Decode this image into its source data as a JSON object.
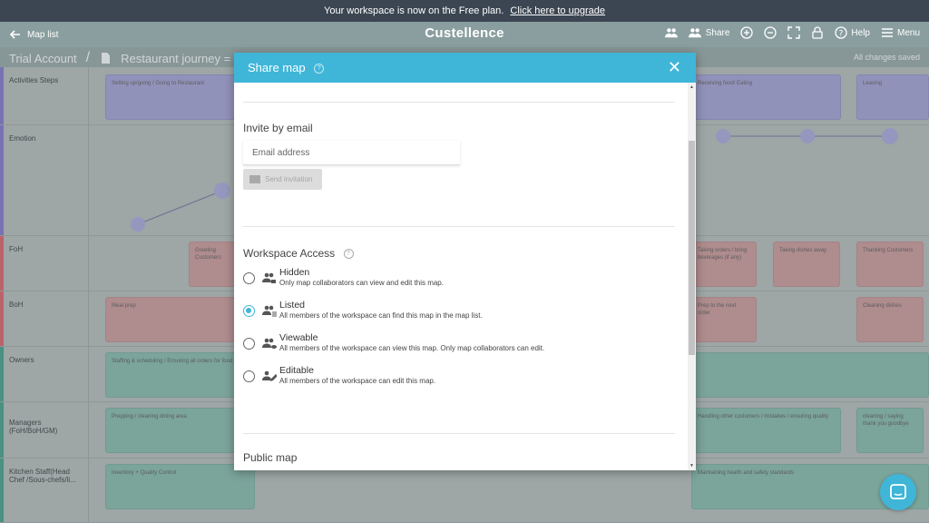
{
  "banner": {
    "message": "Your workspace is now on the Free plan.",
    "upgrade_link": "Click here to upgrade"
  },
  "appbar": {
    "back_label": "Map list",
    "brand": "Custellence",
    "share_label": "Share",
    "help_label": "Help",
    "menu_label": "Menu"
  },
  "subbar": {
    "account": "Trial Account",
    "map_title": "Restaurant journey = fo",
    "saved_status": "All changes saved"
  },
  "rows": [
    {
      "label": "Activities Steps",
      "color": "#7b70c9"
    },
    {
      "label": "Emotion",
      "color": "#7b70c9"
    },
    {
      "label": "FoH",
      "color": "#d45b66"
    },
    {
      "label": "BoH",
      "color": "#d45b66"
    },
    {
      "label": "Owners",
      "color": "#3e9a86"
    },
    {
      "label": "Managers (FoH/BoH/GM)",
      "color": "#3e9a86"
    },
    {
      "label": "Kitchen Staff(Head Chef /Sous-chefs/li...",
      "color": "#3e9a86"
    }
  ],
  "cards": {
    "act1": "Setting up/going / Going to Restaurant",
    "act2": "Receiving food/ Eating",
    "act3": "Leaving",
    "foh1": "Greeting Customers",
    "foh2": "Taking orders / bring beverages (if any)",
    "foh3": "Taking dishes away",
    "foh4": "Thanking Customers",
    "boh1": "Meal prep",
    "boh2": "Prep to the next order",
    "boh3": "Cleaning dishes",
    "own1": "Staffing & scheduling / Ensuring all orders for food",
    "mgr1": "Prepping / cleaning dining area",
    "mgr2": "Handling other customers / mistakes / ensuring quality",
    "mgr3": "cleaning / saying thank you goodbye",
    "kit1": "Inventory + Quality Control",
    "kit2": "Maintaining health and safety standards"
  },
  "modal": {
    "title": "Share map",
    "invite_title": "Invite by email",
    "email_placeholder": "Email address",
    "send_label": "Send invitation",
    "workspace_title": "Workspace Access",
    "public_title": "Public map",
    "selected": "Listed",
    "options": [
      {
        "label": "Hidden",
        "desc": "Only map collaborators can view and edit this map.",
        "icon": "group-lock-icon"
      },
      {
        "label": "Listed",
        "desc": "All members of the workspace can find this map in the map list.",
        "icon": "group-list-icon"
      },
      {
        "label": "Viewable",
        "desc": "All members of the workspace can view this map. Only map collaborators can edit.",
        "icon": "group-eye-icon"
      },
      {
        "label": "Editable",
        "desc": "All members of the workspace can edit this map.",
        "icon": "group-edit-icon"
      }
    ]
  },
  "colors": {
    "accent": "#3fb6d8",
    "banner": "#3b4652"
  }
}
